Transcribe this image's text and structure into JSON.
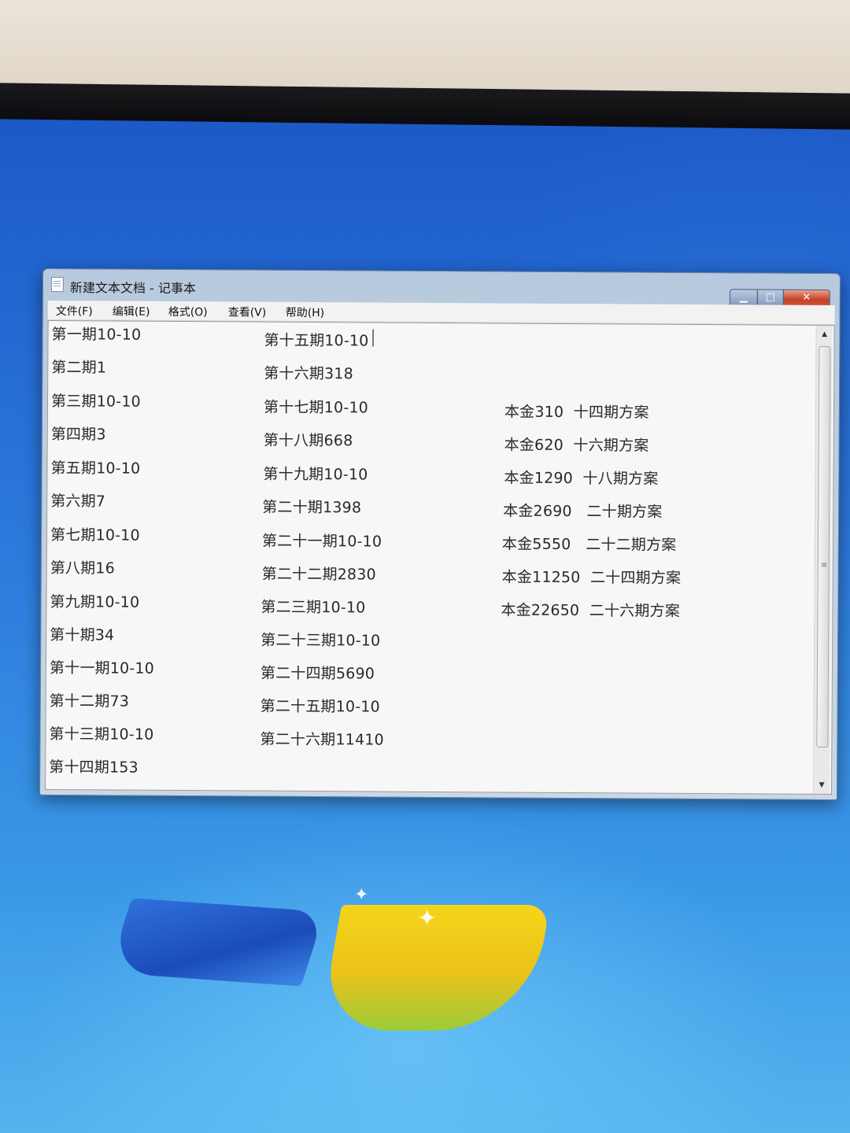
{
  "window": {
    "title": "新建文本文档 - 记事本",
    "controls": {
      "minimize": "▁",
      "maximize": "□",
      "close": "✕"
    }
  },
  "menu": [
    {
      "label": "文件(F)"
    },
    {
      "label": "编辑(E)"
    },
    {
      "label": "格式(O)"
    },
    {
      "label": "查看(V)"
    },
    {
      "label": "帮助(H)"
    }
  ],
  "editor": {
    "column1": [
      "第一期10-10",
      "第二期1",
      "第三期10-10",
      "第四期3",
      "第五期10-10",
      "第六期7",
      "第七期10-10",
      "第八期16",
      "第九期10-10",
      "第十期34",
      "第十一期10-10",
      "第十二期73",
      "第十三期10-10",
      "第十四期153"
    ],
    "column2": [
      "第十五期10-10",
      "第十六期318",
      "第十七期10-10",
      "第十八期668",
      "第十九期10-10",
      "第二十期1398",
      "第二十一期10-10",
      "第二十二期2830",
      "第二三期10-10",
      "第二十三期10-10",
      "第二十四期5690",
      "第二十五期10-10",
      "第二十六期11410"
    ],
    "column3": [
      "本金310  十四期方案",
      "本金620  十六期方案",
      "本金1290  十八期方案",
      "本金2690   二十期方案",
      "本金5550   二十二期方案",
      "本金11250  二十四期方案",
      "本金22650  二十六期方案"
    ]
  },
  "scrollbar": {
    "up": "▲",
    "down": "▼",
    "grip": "≡"
  }
}
